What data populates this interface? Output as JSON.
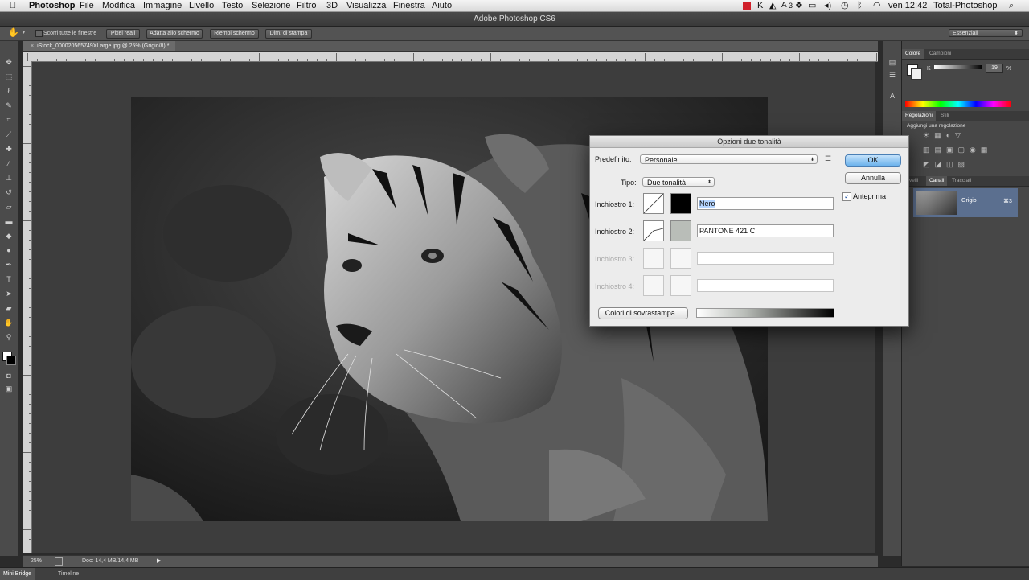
{
  "menubar": {
    "apple": "",
    "app": "Photoshop",
    "items": [
      "File",
      "Modifica",
      "Immagine",
      "Livello",
      "Testo",
      "Selezione",
      "Filtro",
      "3D",
      "Visualizza",
      "Finestra",
      "Aiuto"
    ],
    "status_badge": "3",
    "clock": "ven 12:42",
    "user": "Total-Photoshop"
  },
  "window": {
    "title": "Adobe Photoshop CS6"
  },
  "options_bar": {
    "scroll_all_label": "Scorri tutte le finestre",
    "buttons": [
      "Pixel reali",
      "Adatta allo schermo",
      "Riempi schermo",
      "Dim. di stampa"
    ],
    "workspace": "Essenziali"
  },
  "document": {
    "tab_title": "iStock_000020565749XLarge.jpg @ 25% (Grigio/8) *",
    "zoom": "25%",
    "doc_info": "Doc: 14,4 MB/14,4 MB"
  },
  "bottom_tabs": [
    "Mini Bridge",
    "Timeline"
  ],
  "panels": {
    "color_tabs": [
      "Colore",
      "Campioni"
    ],
    "k_label": "K",
    "k_value": "19",
    "k_unit": "%",
    "adjust_tabs": [
      "Regolazioni",
      "Stili"
    ],
    "adjust_title": "Aggiungi una regolazione",
    "layer_tabs": [
      "Livelli",
      "Canali",
      "Tracciati"
    ],
    "channel_name": "Grigio",
    "channel_shortcut": "⌘3"
  },
  "dialog": {
    "title": "Opzioni due tonalità",
    "preset_label": "Predefinito:",
    "preset_value": "Personale",
    "type_label": "Tipo:",
    "type_value": "Due tonalità",
    "inks": [
      {
        "label": "Inchiostro 1:",
        "name": "Nero",
        "color": "#000000",
        "enabled": true
      },
      {
        "label": "Inchiostro 2:",
        "name": "PANTONE 421 C",
        "color": "#b9bdb8",
        "enabled": true
      },
      {
        "label": "Inchiostro 3:",
        "name": "",
        "color": "",
        "enabled": false
      },
      {
        "label": "Inchiostro 4:",
        "name": "",
        "color": "",
        "enabled": false
      }
    ],
    "overprint_button": "Colori di sovrastampa...",
    "ok": "OK",
    "cancel": "Annulla",
    "preview_label": "Anteprima",
    "preview_checked": true
  },
  "colors": {
    "accent_blue": "#6db3ec",
    "panel_bg": "#474747",
    "canvas_bg": "#3d3d3d"
  }
}
